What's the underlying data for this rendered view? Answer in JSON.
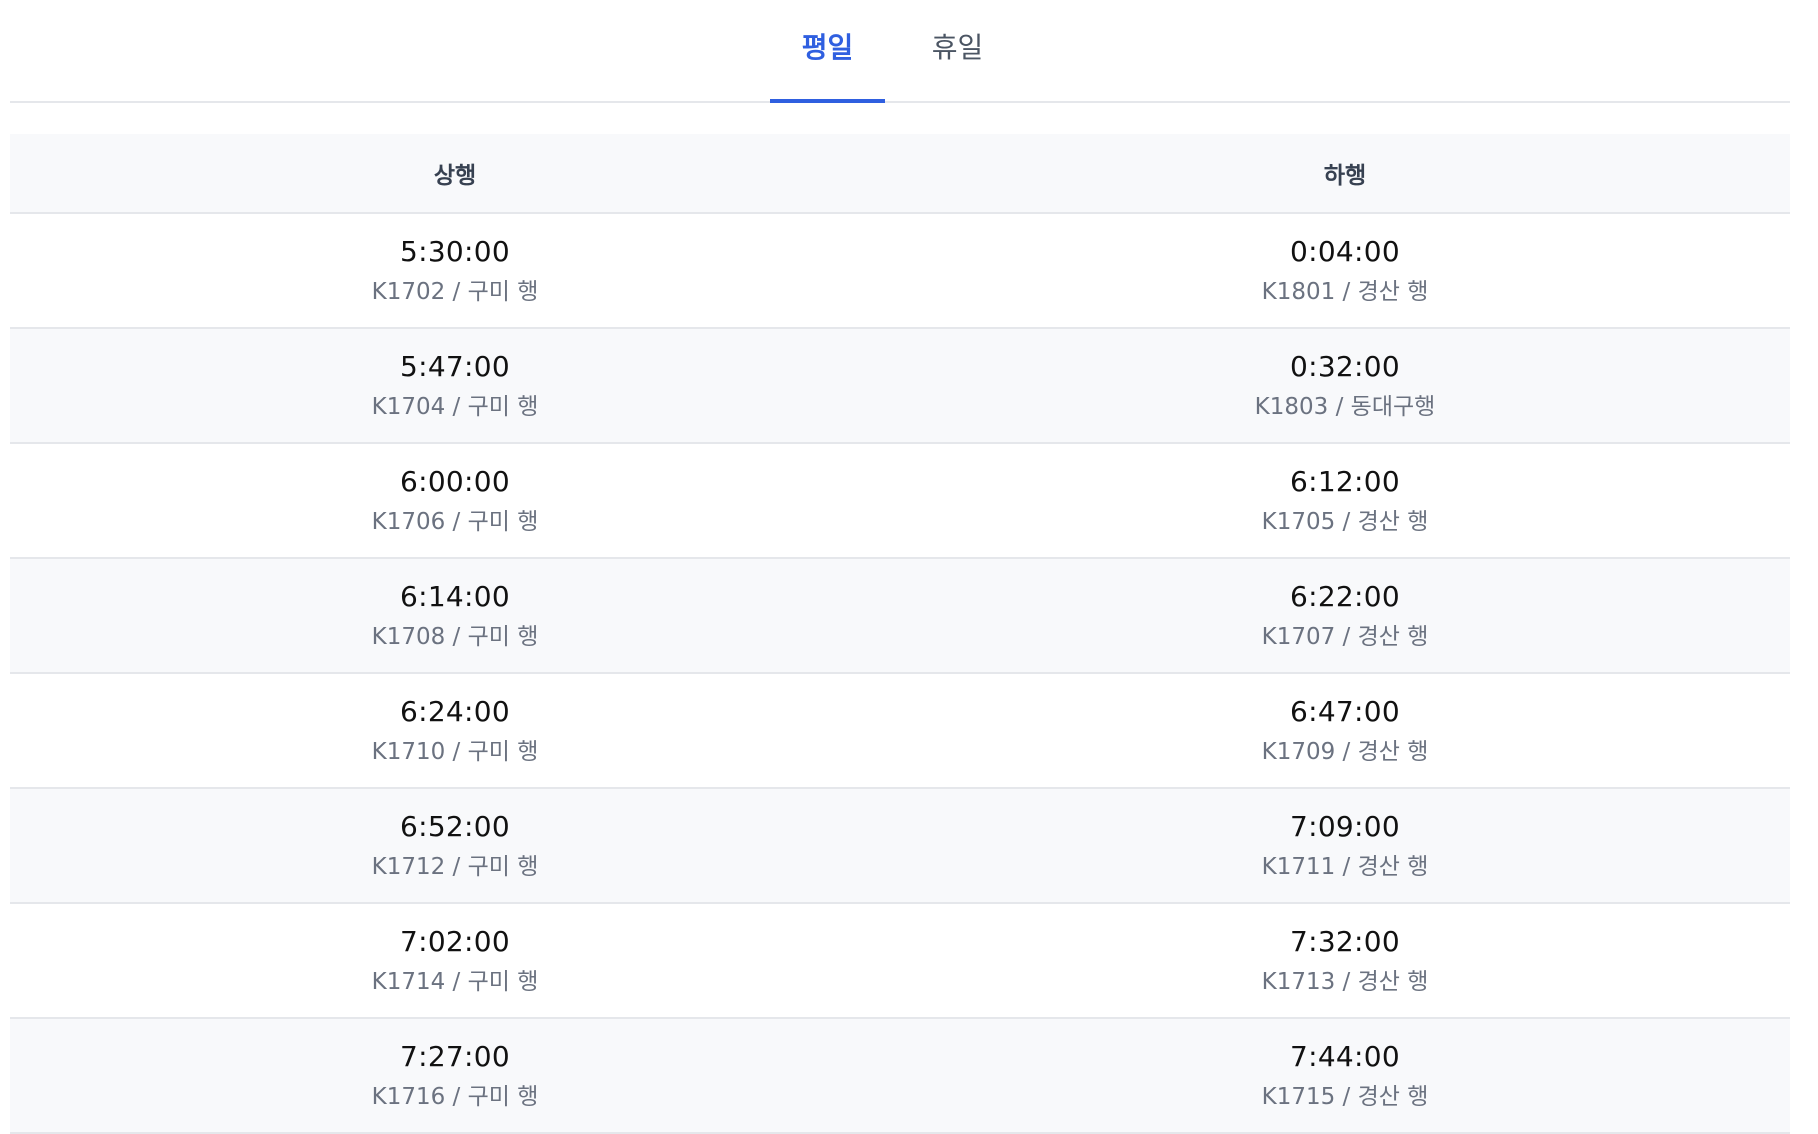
{
  "tabs": [
    {
      "label": "평일",
      "active": true
    },
    {
      "label": "휴일",
      "active": false
    }
  ],
  "colors": {
    "accent": "#2f5fe0",
    "border": "#e5e7eb",
    "alt_row_bg": "#f8f9fb",
    "sub_text": "#6b7280"
  },
  "table": {
    "headers": [
      "상행",
      "하행"
    ],
    "rows": [
      {
        "up": {
          "time": "5:30:00",
          "info": "K1702 / 구미 행"
        },
        "down": {
          "time": "0:04:00",
          "info": "K1801 / 경산 행"
        }
      },
      {
        "up": {
          "time": "5:47:00",
          "info": "K1704 / 구미 행"
        },
        "down": {
          "time": "0:32:00",
          "info": "K1803 / 동대구행"
        }
      },
      {
        "up": {
          "time": "6:00:00",
          "info": "K1706 / 구미 행"
        },
        "down": {
          "time": "6:12:00",
          "info": "K1705 / 경산 행"
        }
      },
      {
        "up": {
          "time": "6:14:00",
          "info": "K1708 / 구미 행"
        },
        "down": {
          "time": "6:22:00",
          "info": "K1707 / 경산 행"
        }
      },
      {
        "up": {
          "time": "6:24:00",
          "info": "K1710 / 구미 행"
        },
        "down": {
          "time": "6:47:00",
          "info": "K1709 / 경산 행"
        }
      },
      {
        "up": {
          "time": "6:52:00",
          "info": "K1712 / 구미 행"
        },
        "down": {
          "time": "7:09:00",
          "info": "K1711 / 경산 행"
        }
      },
      {
        "up": {
          "time": "7:02:00",
          "info": "K1714 / 구미 행"
        },
        "down": {
          "time": "7:32:00",
          "info": "K1713 / 경산 행"
        }
      },
      {
        "up": {
          "time": "7:27:00",
          "info": "K1716 / 구미 행"
        },
        "down": {
          "time": "7:44:00",
          "info": "K1715 / 경산 행"
        }
      }
    ]
  }
}
